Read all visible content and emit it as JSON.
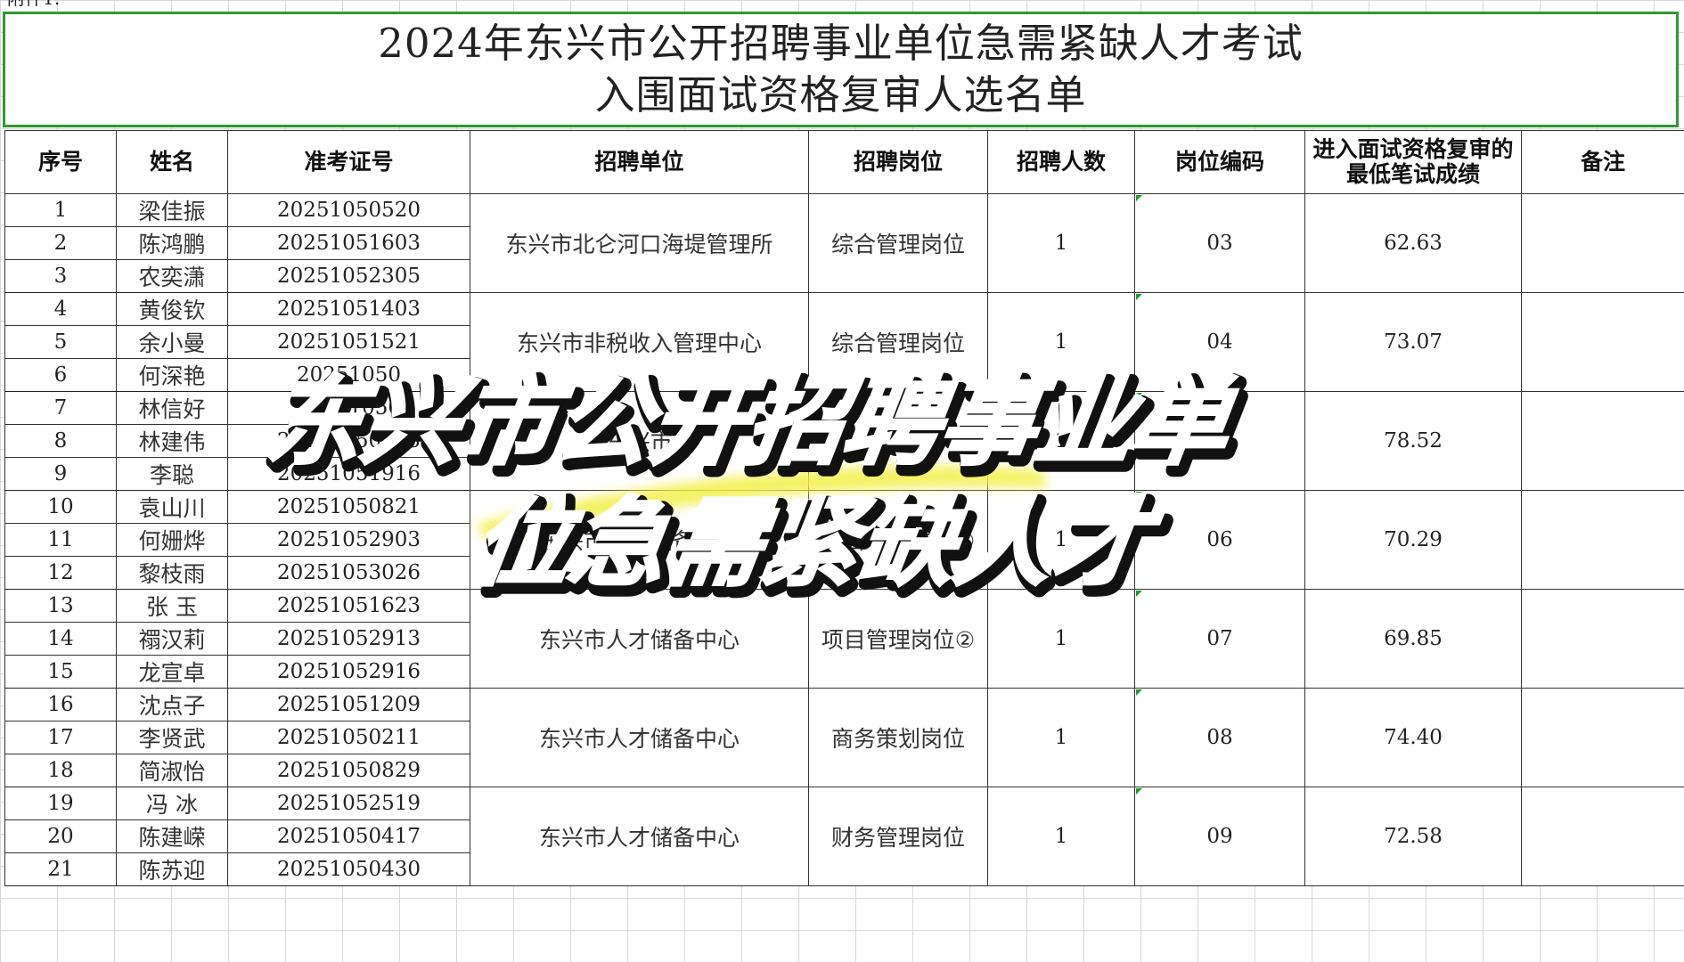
{
  "attachment_label": "附件1:",
  "title": {
    "line1": "2024年东兴市公开招聘事业单位急需紧缺人才考试",
    "line2": "入围面试资格复审人选名单"
  },
  "columns": {
    "seq": "序号",
    "name": "姓名",
    "ticket": "准考证号",
    "unit": "招聘单位",
    "post": "招聘岗位",
    "count": "招聘人数",
    "code": "岗位编码",
    "min_score": "进入面试资格复审的最低笔试成绩",
    "remark": "备注"
  },
  "groups": [
    {
      "unit": "东兴市北仑河口海堤管理所",
      "post": "综合管理岗位",
      "count": "1",
      "code": "03",
      "min_score": "62.63",
      "remark": "",
      "rows": [
        {
          "seq": "1",
          "name": "梁佳振",
          "ticket": "20251050520"
        },
        {
          "seq": "2",
          "name": "陈鸿鹏",
          "ticket": "20251051603"
        },
        {
          "seq": "3",
          "name": "农奕潇",
          "ticket": "20251052305"
        }
      ]
    },
    {
      "unit": "东兴市非税收入管理中心",
      "post": "综合管理岗位",
      "count": "1",
      "code": "04",
      "min_score": "73.07",
      "remark": "",
      "rows": [
        {
          "seq": "4",
          "name": "黄俊钦",
          "ticket": "20251051403"
        },
        {
          "seq": "5",
          "name": "余小曼",
          "ticket": "20251051521"
        },
        {
          "seq": "6",
          "name": "何深艳",
          "ticket": "20251050"
        }
      ]
    },
    {
      "unit": "东兴市",
      "post": "综合",
      "count": "1",
      "code": "05",
      "min_score": "78.52",
      "remark": "",
      "rows": [
        {
          "seq": "7",
          "name": "林信好",
          "ticket": "20251050"
        },
        {
          "seq": "8",
          "name": "林建伟",
          "ticket": "20251050315"
        },
        {
          "seq": "9",
          "name": "李聪",
          "ticket": "20251051916"
        }
      ]
    },
    {
      "unit": "东兴市人才储备中心",
      "post": "项目管理岗位①",
      "count": "1",
      "code": "06",
      "min_score": "70.29",
      "remark": "",
      "rows": [
        {
          "seq": "10",
          "name": "袁山川",
          "ticket": "20251050821"
        },
        {
          "seq": "11",
          "name": "何姗烨",
          "ticket": "20251052903"
        },
        {
          "seq": "12",
          "name": "黎枝雨",
          "ticket": "20251053026"
        }
      ]
    },
    {
      "unit": "东兴市人才储备中心",
      "post": "项目管理岗位②",
      "count": "1",
      "code": "07",
      "min_score": "69.85",
      "remark": "",
      "rows": [
        {
          "seq": "13",
          "name": "张 玉",
          "ticket": "20251051623"
        },
        {
          "seq": "14",
          "name": "禤汉莉",
          "ticket": "20251052913"
        },
        {
          "seq": "15",
          "name": "龙宣卓",
          "ticket": "20251052916"
        }
      ]
    },
    {
      "unit": "东兴市人才储备中心",
      "post": "商务策划岗位",
      "count": "1",
      "code": "08",
      "min_score": "74.40",
      "remark": "",
      "rows": [
        {
          "seq": "16",
          "name": "沈点子",
          "ticket": "20251051209"
        },
        {
          "seq": "17",
          "name": "李贤武",
          "ticket": "20251050211"
        },
        {
          "seq": "18",
          "name": "简淑怡",
          "ticket": "20251050829"
        }
      ]
    },
    {
      "unit": "东兴市人才储备中心",
      "post": "财务管理岗位",
      "count": "1",
      "code": "09",
      "min_score": "72.58",
      "remark": "",
      "rows": [
        {
          "seq": "19",
          "name": "冯 冰",
          "ticket": "20251052519"
        },
        {
          "seq": "20",
          "name": "陈建嵘",
          "ticket": "20251050417"
        },
        {
          "seq": "21",
          "name": "陈苏迎",
          "ticket": "20251050430"
        }
      ]
    }
  ],
  "overlay": {
    "line1": "东兴市公开招聘事业单",
    "line2": "位急需紧缺人才",
    "highlight_color": "#f3f04a"
  }
}
